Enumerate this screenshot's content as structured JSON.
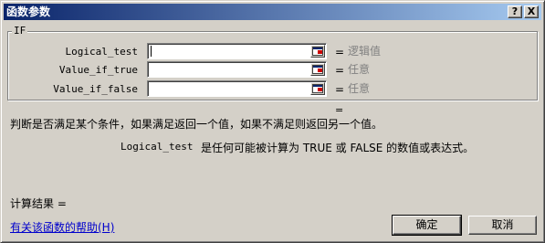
{
  "window": {
    "title": "函数参数",
    "help_btn": "?",
    "close_btn": "X"
  },
  "group": {
    "label": "IF"
  },
  "args": [
    {
      "name": "Logical_test",
      "value": "",
      "eq": "=",
      "result": "逻辑值"
    },
    {
      "name": "Value_if_true",
      "value": "",
      "eq": "=",
      "result": "任意"
    },
    {
      "name": "Value_if_false",
      "value": "",
      "eq": "=",
      "result": "任意"
    }
  ],
  "formula_result_eq": "=",
  "description": "判断是否满足某个条件，如果满足返回一个值，如果不满足则返回另一个值。",
  "arg_desc": {
    "name": "Logical_test",
    "text": "是任何可能被计算为 TRUE 或 FALSE 的数值或表达式。"
  },
  "calc_result": "计算结果 =",
  "help_link": "有关该函数的帮助(H)",
  "buttons": {
    "ok": "确定",
    "cancel": "取消"
  },
  "icons": {
    "collapse_dialog": "collapse-dialog-icon"
  }
}
